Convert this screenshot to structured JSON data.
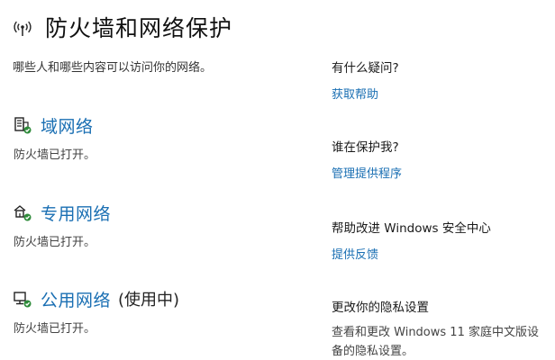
{
  "header": {
    "icon": "wifi-antenna-icon",
    "title": "防火墙和网络保护",
    "subtitle": "哪些人和哪些内容可以访问你的网络。"
  },
  "networks": [
    {
      "icon": "domain-network-icon",
      "label": "域网络",
      "suffix": "",
      "status": "防火墙已打开。"
    },
    {
      "icon": "private-network-icon",
      "label": "专用网络",
      "suffix": "",
      "status": "防火墙已打开。"
    },
    {
      "icon": "public-network-icon",
      "label": "公用网络",
      "suffix": "(使用中)",
      "status": "防火墙已打开。"
    }
  ],
  "side": {
    "help": {
      "title": "有什么疑问?",
      "link": "获取帮助"
    },
    "protector": {
      "title": "谁在保护我?",
      "link": "管理提供程序"
    },
    "feedback": {
      "title": "帮助改进 Windows 安全中心",
      "link": "提供反馈"
    },
    "privacy": {
      "title": "更改你的隐私设置",
      "text": "查看和更改 Windows 11 家庭中文版设备的隐私设置。"
    }
  },
  "colors": {
    "link": "#1a6fb3",
    "check_badge": "#2e8b3a"
  }
}
